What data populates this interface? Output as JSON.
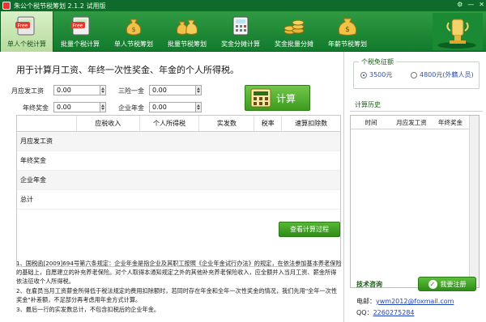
{
  "window": {
    "title": "朱公个税节税筹划 2.1.2 试用版",
    "controls": [
      "⚙",
      "—",
      "✕"
    ]
  },
  "toolbar": {
    "items": [
      {
        "label": "单人个税计算",
        "icon": "calculator-free-icon",
        "active": true
      },
      {
        "label": "批量个税计算",
        "icon": "calculator-free-icon",
        "active": false
      },
      {
        "label": "单人节税筹划",
        "icon": "money-bag-icon",
        "active": false
      },
      {
        "label": "批量节税筹划",
        "icon": "money-bags-icon",
        "active": false
      },
      {
        "label": "奖金分摊计算",
        "icon": "calculator-icon",
        "active": false
      },
      {
        "label": "奖金批量分摊",
        "icon": "coins-icon",
        "active": false
      },
      {
        "label": "年薪节税筹划",
        "icon": "dollar-bag-icon",
        "active": false
      }
    ]
  },
  "form": {
    "heading": "用于计算月工资、年终一次性奖金、年金的个人所得税。",
    "monthly_salary_label": "月应发工资",
    "monthly_salary_value": "0.00",
    "social_label": "三险一金",
    "social_value": "0.00",
    "bonus_label": "年终奖金",
    "bonus_value": "0.00",
    "annuity_label": "企业年金",
    "annuity_value": "0.00",
    "calc_button": "计算"
  },
  "table": {
    "columns": [
      "",
      "应税收入",
      "个人所得税",
      "实发数",
      "税率",
      "速算扣除数"
    ],
    "rows": [
      {
        "label": "月应发工资"
      },
      {
        "label": "年终奖金"
      },
      {
        "label": "企业年金"
      },
      {
        "label": "总计"
      }
    ]
  },
  "detail_button": "查看计算过程",
  "notes": [
    "1、国税函[2009]694号第六条规定：企业年金是指企业及其职工按照《企业年金试行办法》的规定，在依法参加基本养老保险的基础上，自愿建立的补充养老保险。对个人取得本通知规定之外的其他补充养老保险收入，应全额并入当月工资、薪金所得依法征收个人所得税。",
    "2、在雇员当月工资薪金所得低于税法规定的费用扣除额时，若同时存在年金和全年一次性奖金的情况，我们先用\"全年一次性奖金\"补差额，不足部分再考虑用年金方式计算。",
    "3、最后一行的实发数总计，不包含扣税后的企业年金。"
  ],
  "exemption": {
    "title": "个税免征额",
    "options": [
      {
        "label": "3500元",
        "selected": true
      },
      {
        "label": "4800元(外籍人员)",
        "selected": false
      }
    ]
  },
  "history": {
    "title": "计算历史",
    "columns": [
      "时间",
      "月应发工资",
      "年终奖金"
    ]
  },
  "support": {
    "title": "技术咨询",
    "register_button": "我要注册",
    "email_label": "电邮：",
    "email": "ywm2012@foxmail.com",
    "qq_label": "QQ：",
    "qq": "2260275284"
  },
  "colors": {
    "brand_green": "#127a2d",
    "accent_green": "#3d9c1f",
    "link_blue": "#1f44b8"
  }
}
